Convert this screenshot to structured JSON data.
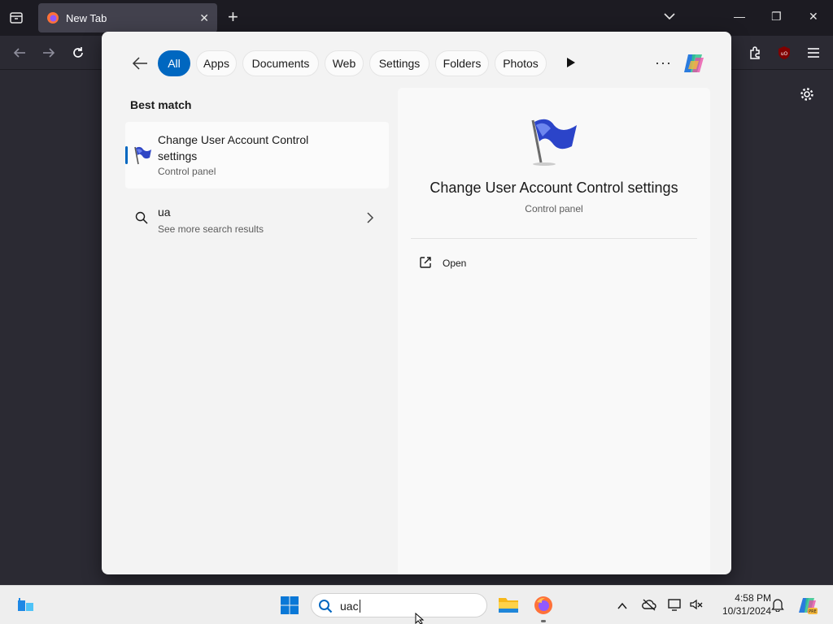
{
  "browser": {
    "tab_title": "New Tab",
    "tab_close": "✕",
    "new_tab": "+",
    "window_min": "—",
    "window_restore": "❐",
    "window_close": "✕"
  },
  "search": {
    "filters": [
      "All",
      "Apps",
      "Documents",
      "Web",
      "Settings",
      "Folders",
      "Photos"
    ],
    "active_filter": "All",
    "more_label": "···",
    "best_match_label": "Best match",
    "best_match": {
      "name": "Change User Account Control settings",
      "type": "Control panel"
    },
    "web_suggestion": {
      "query": "ua",
      "subtitle": "See more search results"
    },
    "detail": {
      "title": "Change User Account Control settings",
      "type": "Control panel",
      "actions": [
        "Open"
      ]
    }
  },
  "taskbar": {
    "search_value": "uac",
    "time": "4:58 PM",
    "date": "10/31/2024"
  },
  "colors": {
    "accent": "#0067c0",
    "browser_bg": "#2b2a33",
    "taskbar_bg": "#eeeeee"
  }
}
